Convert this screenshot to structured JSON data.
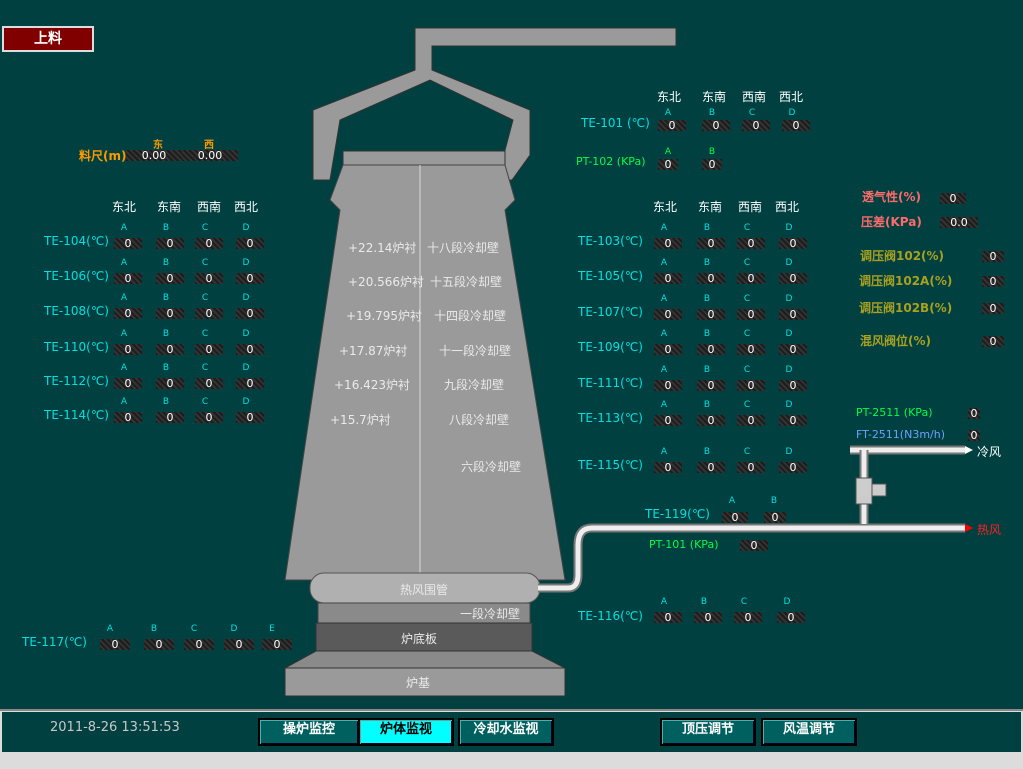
{
  "top_button": "上料",
  "ruler": {
    "label": "料尺(m)",
    "east": "东",
    "west": "西",
    "east_val": "0.00",
    "west_val": "0.00"
  },
  "dir_headers": [
    "东北",
    "东南",
    "西南",
    "西北"
  ],
  "abcd": [
    "A",
    "B",
    "C",
    "D"
  ],
  "abcde": [
    "A",
    "B",
    "C",
    "D",
    "E"
  ],
  "ab": [
    "A",
    "B"
  ],
  "left_sensors": [
    {
      "name": "TE-104(℃)",
      "values": [
        "0",
        "0",
        "0",
        "0"
      ]
    },
    {
      "name": "TE-106(℃)",
      "values": [
        "0",
        "0",
        "0",
        "0"
      ]
    },
    {
      "name": "TE-108(℃)",
      "values": [
        "0",
        "0",
        "0",
        "0"
      ]
    },
    {
      "name": "TE-110(℃)",
      "values": [
        "0",
        "0",
        "0",
        "0"
      ]
    },
    {
      "name": "TE-112(℃)",
      "values": [
        "0",
        "0",
        "0",
        "0"
      ]
    },
    {
      "name": "TE-114(℃)",
      "values": [
        "0",
        "0",
        "0",
        "0"
      ]
    }
  ],
  "te117": {
    "name": "TE-117(℃)",
    "values": [
      "0",
      "0",
      "0",
      "0",
      "0"
    ]
  },
  "te101": {
    "name": "TE-101 (℃)",
    "values": [
      "0",
      "0",
      "0",
      "0"
    ]
  },
  "pt102": {
    "name": "PT-102 (KPa)",
    "values": [
      "0",
      "0"
    ]
  },
  "right_sensors": [
    {
      "name": "TE-103(℃)",
      "values": [
        "0",
        "0",
        "0",
        "0"
      ]
    },
    {
      "name": "TE-105(℃)",
      "values": [
        "0",
        "0",
        "0",
        "0"
      ]
    },
    {
      "name": "TE-107(℃)",
      "values": [
        "0",
        "0",
        "0",
        "0"
      ]
    },
    {
      "name": "TE-109(℃)",
      "values": [
        "0",
        "0",
        "0",
        "0"
      ]
    },
    {
      "name": "TE-111(℃)",
      "values": [
        "0",
        "0",
        "0",
        "0"
      ]
    },
    {
      "name": "TE-113(℃)",
      "values": [
        "0",
        "0",
        "0",
        "0"
      ]
    },
    {
      "name": "TE-115(℃)",
      "values": [
        "0",
        "0",
        "0",
        "0"
      ]
    }
  ],
  "te116": {
    "name": "TE-116(℃)",
    "values": [
      "0",
      "0",
      "0",
      "0"
    ]
  },
  "te119": {
    "name": "TE-119(℃)",
    "values": [
      "0",
      "0"
    ]
  },
  "pt101": {
    "name": "PT-101 (KPa)",
    "value": "0"
  },
  "pt2511": {
    "name": "PT-2511 (KPa)",
    "value": "0"
  },
  "ft2511": {
    "name": "FT-2511(N3m/h)",
    "value": "0"
  },
  "cold_wind": "冷风",
  "hot_wind": "热风",
  "right_params": [
    {
      "name": "透气性(%)",
      "value": "0"
    },
    {
      "name": "压差(KPa)",
      "value": "0.0"
    }
  ],
  "valves": [
    {
      "name": "调压阀102(%)",
      "value": "0"
    },
    {
      "name": "调压阀102A(%)",
      "value": "0"
    },
    {
      "name": "调压阀102B(%)",
      "value": "0"
    },
    {
      "name": "混风阀位(%)",
      "value": "0"
    }
  ],
  "furnace": {
    "levels": [
      "+22.14炉衬",
      "+20.566炉衬",
      "+19.795炉衬",
      "+17.87炉衬",
      "+16.423炉衬",
      "+15.7炉衬"
    ],
    "segments": [
      "十八段冷却壁",
      "十五段冷却壁",
      "十四段冷却壁",
      "十一段冷却壁",
      "九段冷却壁",
      "八段冷却壁",
      "六段冷却壁"
    ],
    "bustle": "热风围管",
    "seg1": "一段冷却壁",
    "bottom": "炉底板",
    "base": "炉基"
  },
  "timestamp": "2011-8-26 13:51:53",
  "nav": [
    "操炉监控",
    "炉体监视",
    "冷却水监视",
    "顶压调节",
    "风温调节"
  ]
}
